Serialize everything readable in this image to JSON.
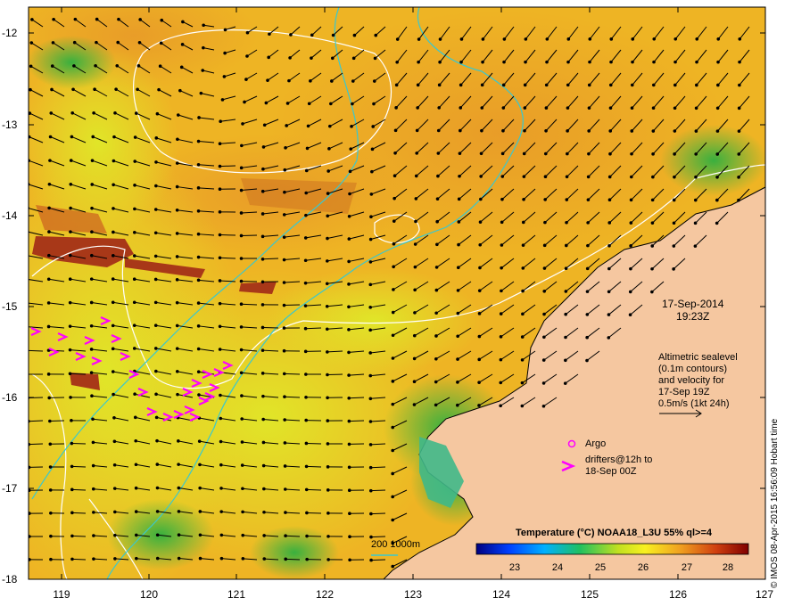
{
  "map": {
    "lat_ticks": [
      "-12",
      "-13",
      "-14",
      "-15",
      "-16",
      "-17",
      "-18"
    ],
    "lon_ticks": [
      "119",
      "120",
      "121",
      "122",
      "123",
      "124",
      "125",
      "126",
      "127"
    ],
    "date": "17-Sep-2014",
    "time": "19:23Z",
    "altimetry_lines": [
      "Altimetric sealevel",
      "(0.1m contours)",
      "and velocity for",
      "17-Sep 19Z",
      "0.5m/s (1kt 24h)"
    ],
    "argo_label": "Argo",
    "drifters_lines": [
      "drifters@12h to",
      "18-Sep 00Z"
    ],
    "depth_label": "200  1000m",
    "credit": "© IMOS 08-Apr-2015 16:56:09 Hobart time"
  },
  "colorbar": {
    "title": "Temperature (°C) NOAA18_L3U 55% ql>=4",
    "ticks": [
      "23",
      "24",
      "25",
      "26",
      "27",
      "28"
    ]
  },
  "colors": {
    "land": "#f5c7a0",
    "warm_sst": "#e8a020",
    "mid_sst": "#d8d820",
    "cool_sst": "#38b040",
    "drifters": "#ff00ff",
    "isobath": "#38c8d0",
    "contour": "#ffffff"
  }
}
